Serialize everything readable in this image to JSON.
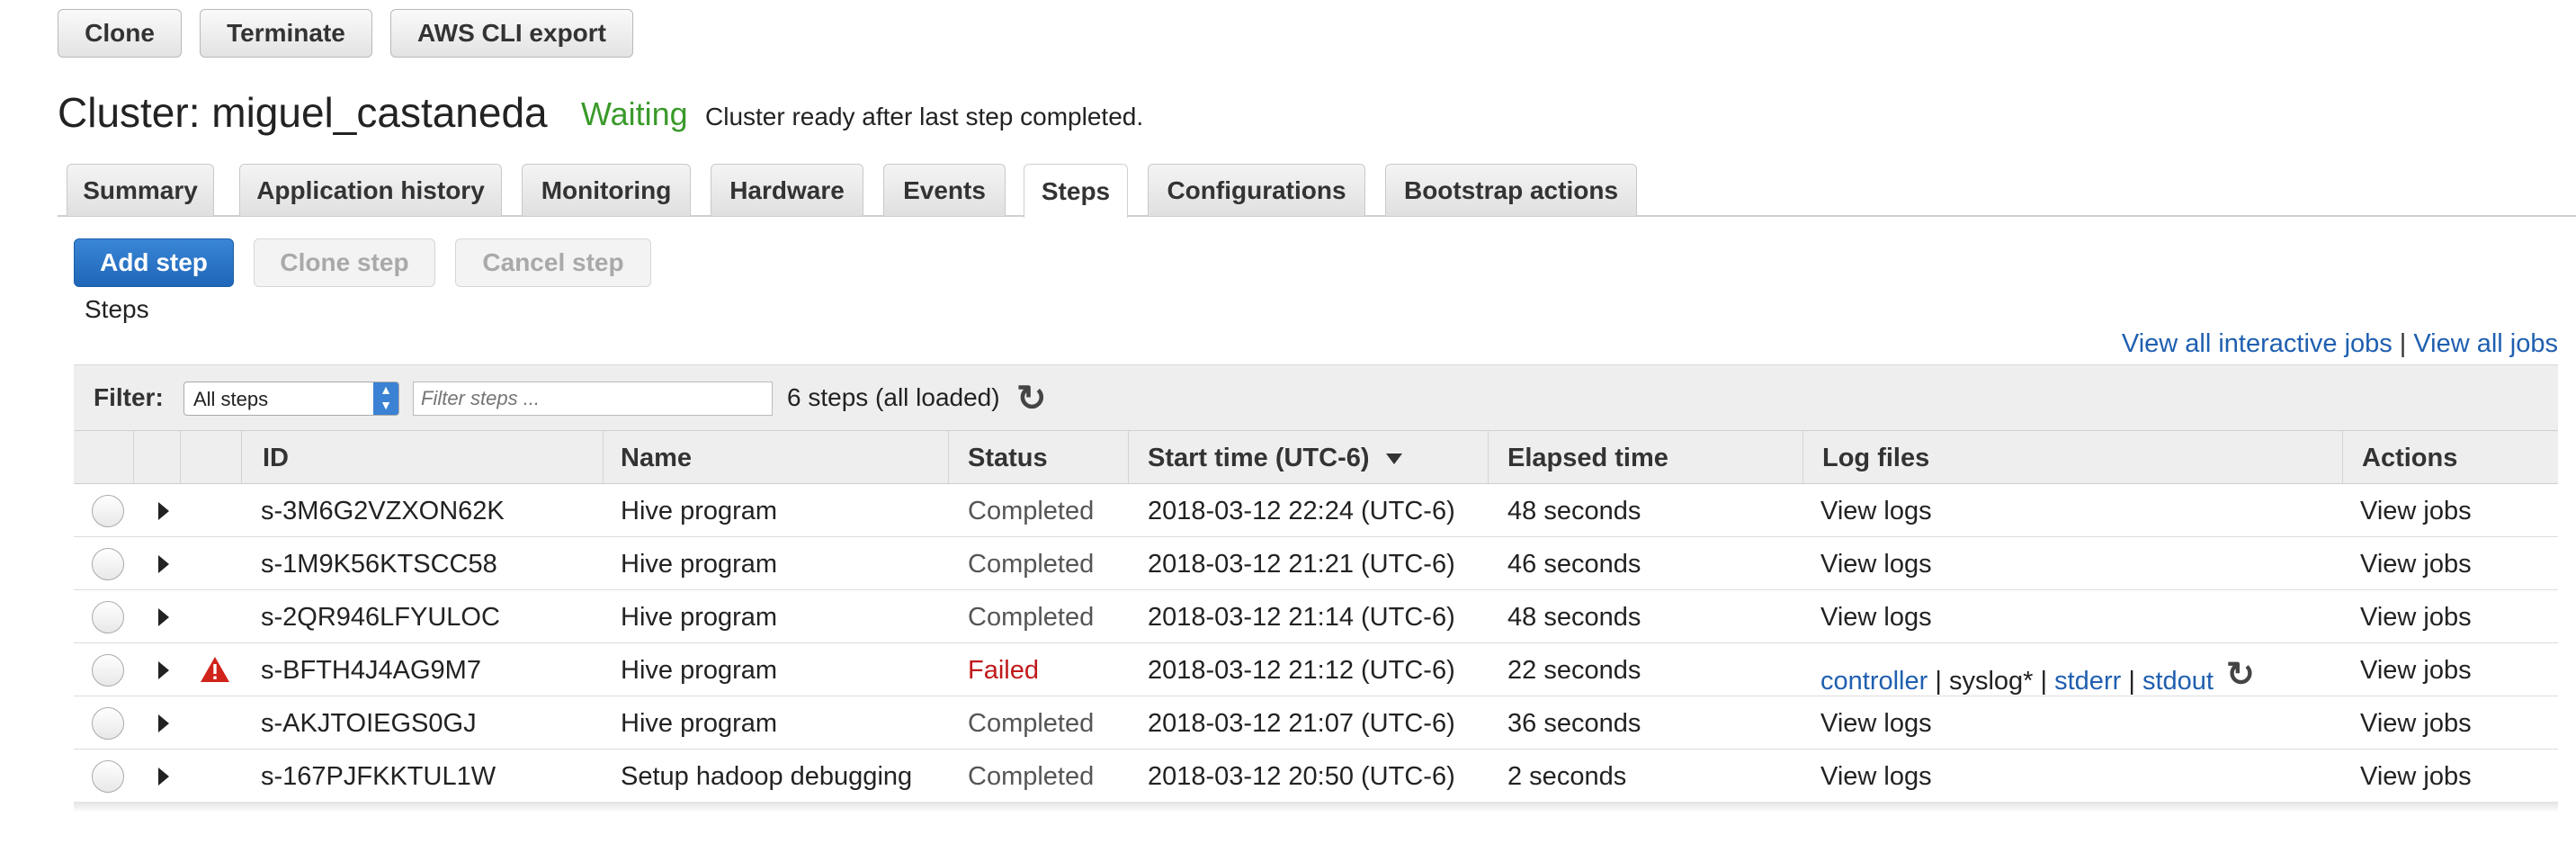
{
  "toolbar": {
    "clone": "Clone",
    "terminate": "Terminate",
    "cli_export": "AWS CLI export"
  },
  "cluster": {
    "title": "Cluster: miguel_castaneda",
    "state": "Waiting",
    "state_message": "Cluster ready after last step completed.",
    "state_color": "#3a9a2a"
  },
  "tabs": [
    "Summary",
    "Application history",
    "Monitoring",
    "Hardware",
    "Events",
    "Steps",
    "Configurations",
    "Bootstrap actions"
  ],
  "active_tab": "Steps",
  "steps_toolbar": {
    "add": "Add step",
    "clone": "Clone step",
    "cancel": "Cancel step",
    "section_label": "Steps"
  },
  "links": {
    "interactive_jobs": "View all interactive jobs",
    "separator": "|",
    "all_jobs": "View all jobs"
  },
  "filter": {
    "label": "Filter:",
    "selected": "All steps",
    "placeholder": "Filter steps ...",
    "count": "6 steps (all loaded)"
  },
  "columns": {
    "id": "ID",
    "name": "Name",
    "status": "Status",
    "start_time": "Start time (UTC-6)",
    "elapsed": "Elapsed time",
    "log_files": "Log files",
    "actions": "Actions"
  },
  "rows": [
    {
      "id": "s-3M6G2VZXON62K",
      "name": "Hive program",
      "status": "Completed",
      "start": "2018-03-12 22:24 (UTC-6)",
      "elapsed": "48 seconds",
      "logs": "View logs",
      "action": "View jobs"
    },
    {
      "id": "s-1M9K56KTSCC58",
      "name": "Hive program",
      "status": "Completed",
      "start": "2018-03-12 21:21 (UTC-6)",
      "elapsed": "46 seconds",
      "logs": "View logs",
      "action": "View jobs"
    },
    {
      "id": "s-2QR946LFYULOC",
      "name": "Hive program",
      "status": "Completed",
      "start": "2018-03-12 21:14 (UTC-6)",
      "elapsed": "48 seconds",
      "logs": "View logs",
      "action": "View jobs"
    },
    {
      "id": "s-BFTH4J4AG9M7",
      "name": "Hive program",
      "status": "Failed",
      "start": "2018-03-12 21:12 (UTC-6)",
      "elapsed": "22 seconds",
      "logs": "",
      "action": "View jobs",
      "log_links": {
        "controller": "controller",
        "syslog": "syslog*",
        "stderr": "stderr",
        "stdout": "stdout",
        "sep": "|"
      }
    },
    {
      "id": "s-AKJTOIEGS0GJ",
      "name": "Hive program",
      "status": "Completed",
      "start": "2018-03-12 21:07 (UTC-6)",
      "elapsed": "36 seconds",
      "logs": "View logs",
      "action": "View jobs"
    },
    {
      "id": "s-167PJFKKTUL1W",
      "name": "Setup hadoop debugging",
      "status": "Completed",
      "start": "2018-03-12 20:50 (UTC-6)",
      "elapsed": "2 seconds",
      "logs": "View logs",
      "action": "View jobs"
    }
  ]
}
